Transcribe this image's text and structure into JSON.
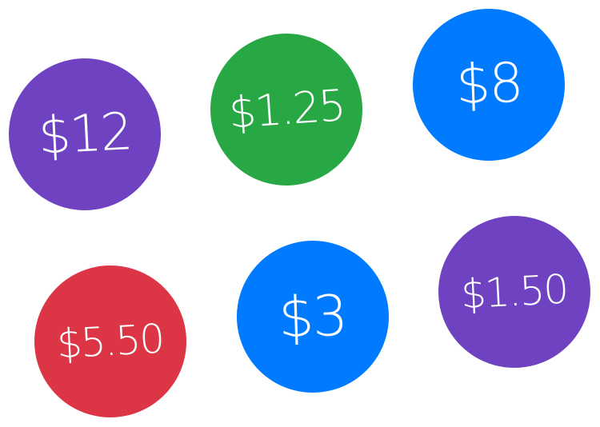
{
  "tags": [
    {
      "id": "12",
      "label": "$12",
      "color": "#6f42c1"
    },
    {
      "id": "125",
      "label": "$1.25",
      "color": "#28a745"
    },
    {
      "id": "8",
      "label": "$8",
      "color": "#007bff"
    },
    {
      "id": "550",
      "label": "$5.50",
      "color": "#dc3545"
    },
    {
      "id": "3",
      "label": "$3",
      "color": "#007bff"
    },
    {
      "id": "150",
      "label": "$1.50",
      "color": "#6f42c1"
    }
  ]
}
